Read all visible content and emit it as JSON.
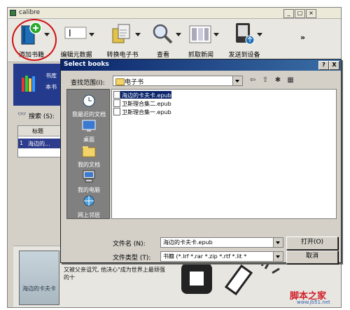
{
  "app": {
    "title": "calibre"
  },
  "toolbar": {
    "add_books": "添加书籍",
    "edit_metadata": "编辑元数据",
    "convert": "转换电子书",
    "view": "查看",
    "fetch_news": "抓取新闻",
    "send_to_device": "发送到设备",
    "more": "»"
  },
  "library": {
    "line1": "书库",
    "line2": "本书"
  },
  "search": {
    "label": "搜索 (S):"
  },
  "table": {
    "col_title": "标题",
    "row_num": "1",
    "row_title": "海边的..."
  },
  "bottom": {
    "cover_title": "海边的卡夫卡",
    "blurb": "注释: 主人公田村卡夫卡君不是随处可见的普通的十五岁少年。他幼年时被母亲抛弃, 又被父亲诅咒, 他决心\"成为世界上最顽强的十"
  },
  "dialog": {
    "title": "Select books",
    "help": "?",
    "close": "X",
    "look_in_label": "查找范围(I):",
    "look_in_value": "电子书",
    "places": [
      {
        "label": "我最近的文档"
      },
      {
        "label": "桌面"
      },
      {
        "label": "我的文档"
      },
      {
        "label": "我的电脑"
      },
      {
        "label": "网上邻居"
      }
    ],
    "files": [
      {
        "name": "海边的卡夫卡.epub"
      },
      {
        "name": "卫斯理合集二.epub"
      },
      {
        "name": "卫斯理合集一.epub"
      }
    ],
    "file_name_label": "文件名 (N):",
    "file_name_value": "海边的卡夫卡.epub",
    "file_type_label": "文件类型 (T):",
    "file_type_value": "书籍 (*.lrf *.rar *.zip *.rtf *.lit *",
    "open_button": "打开(O)",
    "cancel_button": "取消"
  },
  "watermark": {
    "line1": "脚本之家",
    "line2": "www.jb51.net"
  }
}
